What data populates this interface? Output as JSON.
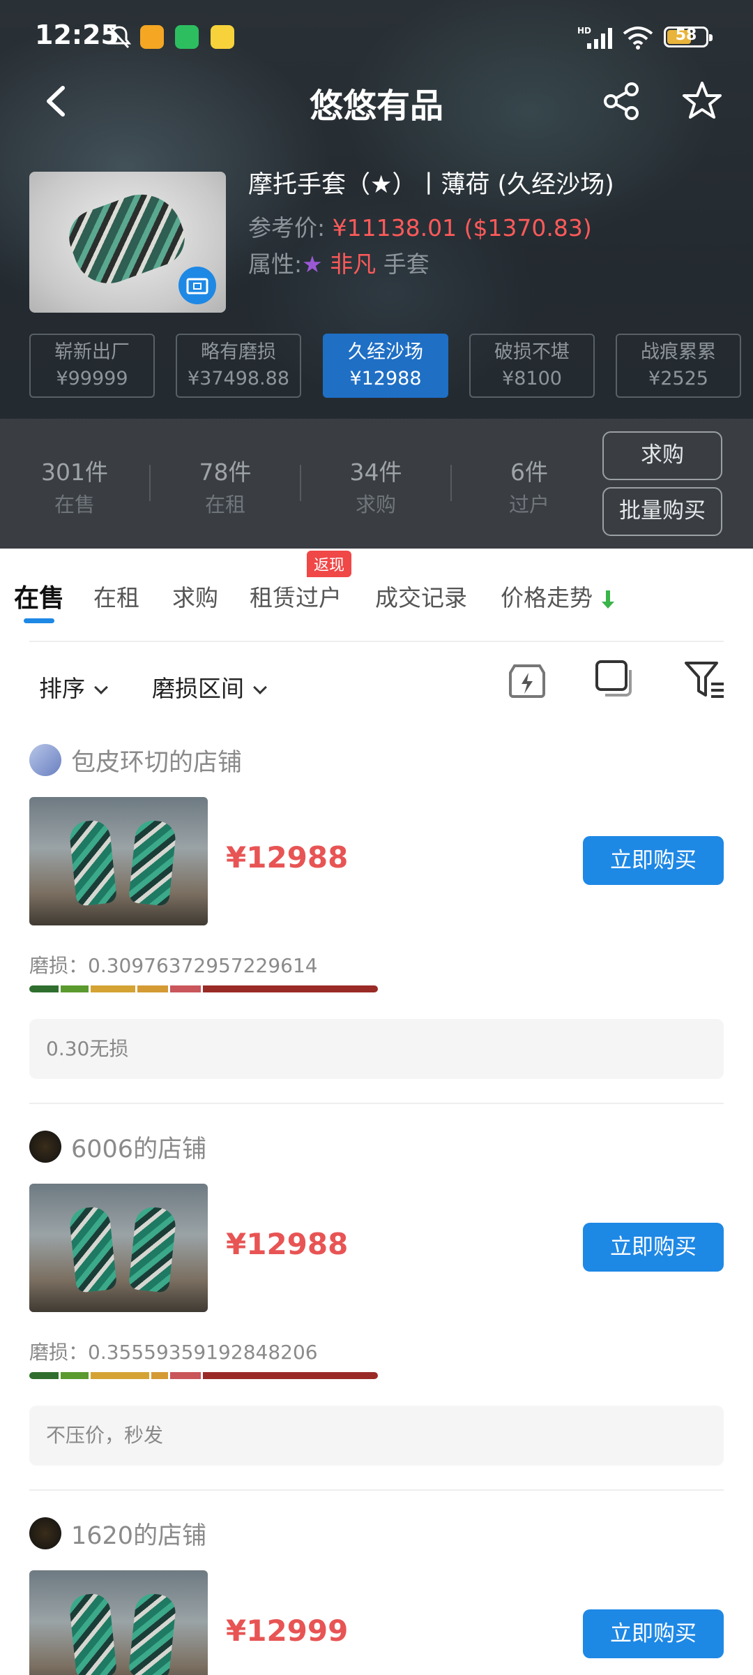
{
  "status_bar": {
    "time": "12:25",
    "battery": "58",
    "battery_level": 0.58
  },
  "header": {
    "title": "悠悠有品"
  },
  "product": {
    "name": "摩托手套（★）丨薄荷 (久经沙场)",
    "ref_label": "参考价:",
    "ref_price": "¥11138.01 ($1370.83)",
    "attr_label": "属性:",
    "attr_star": "★",
    "attr_rarity": "非凡",
    "attr_type": "手套"
  },
  "wear_chips": [
    {
      "name": "崭新出厂",
      "price": "¥99999",
      "active": false
    },
    {
      "name": "略有磨损",
      "price": "¥37498.88",
      "active": false
    },
    {
      "name": "久经沙场",
      "price": "¥12988",
      "active": true
    },
    {
      "name": "破损不堪",
      "price": "¥8100",
      "active": false
    },
    {
      "name": "战痕累累",
      "price": "¥2525",
      "active": false
    }
  ],
  "stats": [
    {
      "count": "301件",
      "label": "在售"
    },
    {
      "count": "78件",
      "label": "在租"
    },
    {
      "count": "34件",
      "label": "求购"
    },
    {
      "count": "6件",
      "label": "过户"
    }
  ],
  "actions": {
    "request_buy": "求购",
    "bulk_buy": "批量购买"
  },
  "tabs": {
    "items": [
      "在售",
      "在租",
      "求购",
      "租赁过户",
      "成交记录",
      "价格走势"
    ],
    "active_index": 0,
    "badge": "返现"
  },
  "filters": {
    "sort": "排序",
    "wear_range": "磨损区间"
  },
  "listings": [
    {
      "shop": "包皮环切的店铺",
      "price": "¥12988",
      "buy": "立即购买",
      "wear_prefix": "磨损：",
      "wear": "0.30976372957229614",
      "wear_value": 0.30976372957229614,
      "note": "0.30无损"
    },
    {
      "shop": "6006的店铺",
      "price": "¥12988",
      "buy": "立即购买",
      "wear_prefix": "磨损：",
      "wear": "0.35559359192848206",
      "wear_value": 0.35559359192848206,
      "note": "不压价，秒发"
    },
    {
      "shop": "1620的店铺",
      "price": "¥12999",
      "buy": "立即购买"
    }
  ],
  "colors": {
    "accent": "#1e88e5",
    "price_red": "#e85454",
    "rarity_purple": "#9b59d6",
    "badge_red": "#f04747"
  }
}
